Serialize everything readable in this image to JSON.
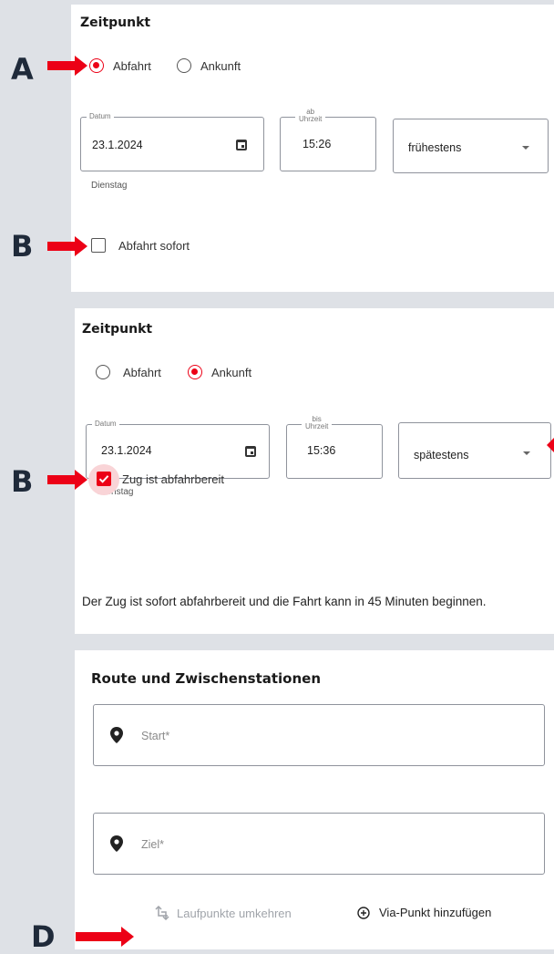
{
  "markers": {
    "a": "A",
    "b1": "B",
    "b2": "B",
    "d": "D"
  },
  "panel1": {
    "title": "Zeitpunkt",
    "radio_departure": "Abfahrt",
    "radio_arrival": "Ankunft",
    "selected": "Abfahrt",
    "date_legend": "Datum",
    "date_value": "23.1.2024",
    "weekday": "Dienstag",
    "time_legend_top": "ab",
    "time_legend_bottom": "Uhrzeit",
    "time_value": "15:26",
    "mode_value": "frühestens",
    "checkbox_label": "Abfahrt sofort",
    "checkbox_checked": false
  },
  "panel2": {
    "title": "Zeitpunkt",
    "radio_departure": "Abfahrt",
    "radio_arrival": "Ankunft",
    "selected": "Ankunft",
    "date_legend": "Datum",
    "date_value": "23.1.2024",
    "weekday": "Dienstag",
    "time_legend_top": "bis",
    "time_legend_bottom": "Uhrzeit",
    "time_value": "15:36",
    "mode_value": "spätestens",
    "checkbox_label": "Zug ist abfahrbereit",
    "checkbox_checked": true,
    "info_text": "Der Zug ist sofort abfahrbereit und die Fahrt kann in 45 Minuten beginnen."
  },
  "panel3": {
    "title": "Route und Zwischenstationen",
    "start_placeholder": "Start*",
    "destination_placeholder": "Ziel*",
    "reverse_label": "Laufpunkte umkehren",
    "add_via_label": "Via-Punkt hinzufügen"
  },
  "colors": {
    "accent": "#ec0016",
    "background": "#dee1e6",
    "marker": "#1f2a3a"
  },
  "icons": [
    "calendar-icon",
    "chevron-down-icon",
    "location-pin-icon",
    "swap-icon",
    "add-circle-icon",
    "arrow-icon"
  ]
}
